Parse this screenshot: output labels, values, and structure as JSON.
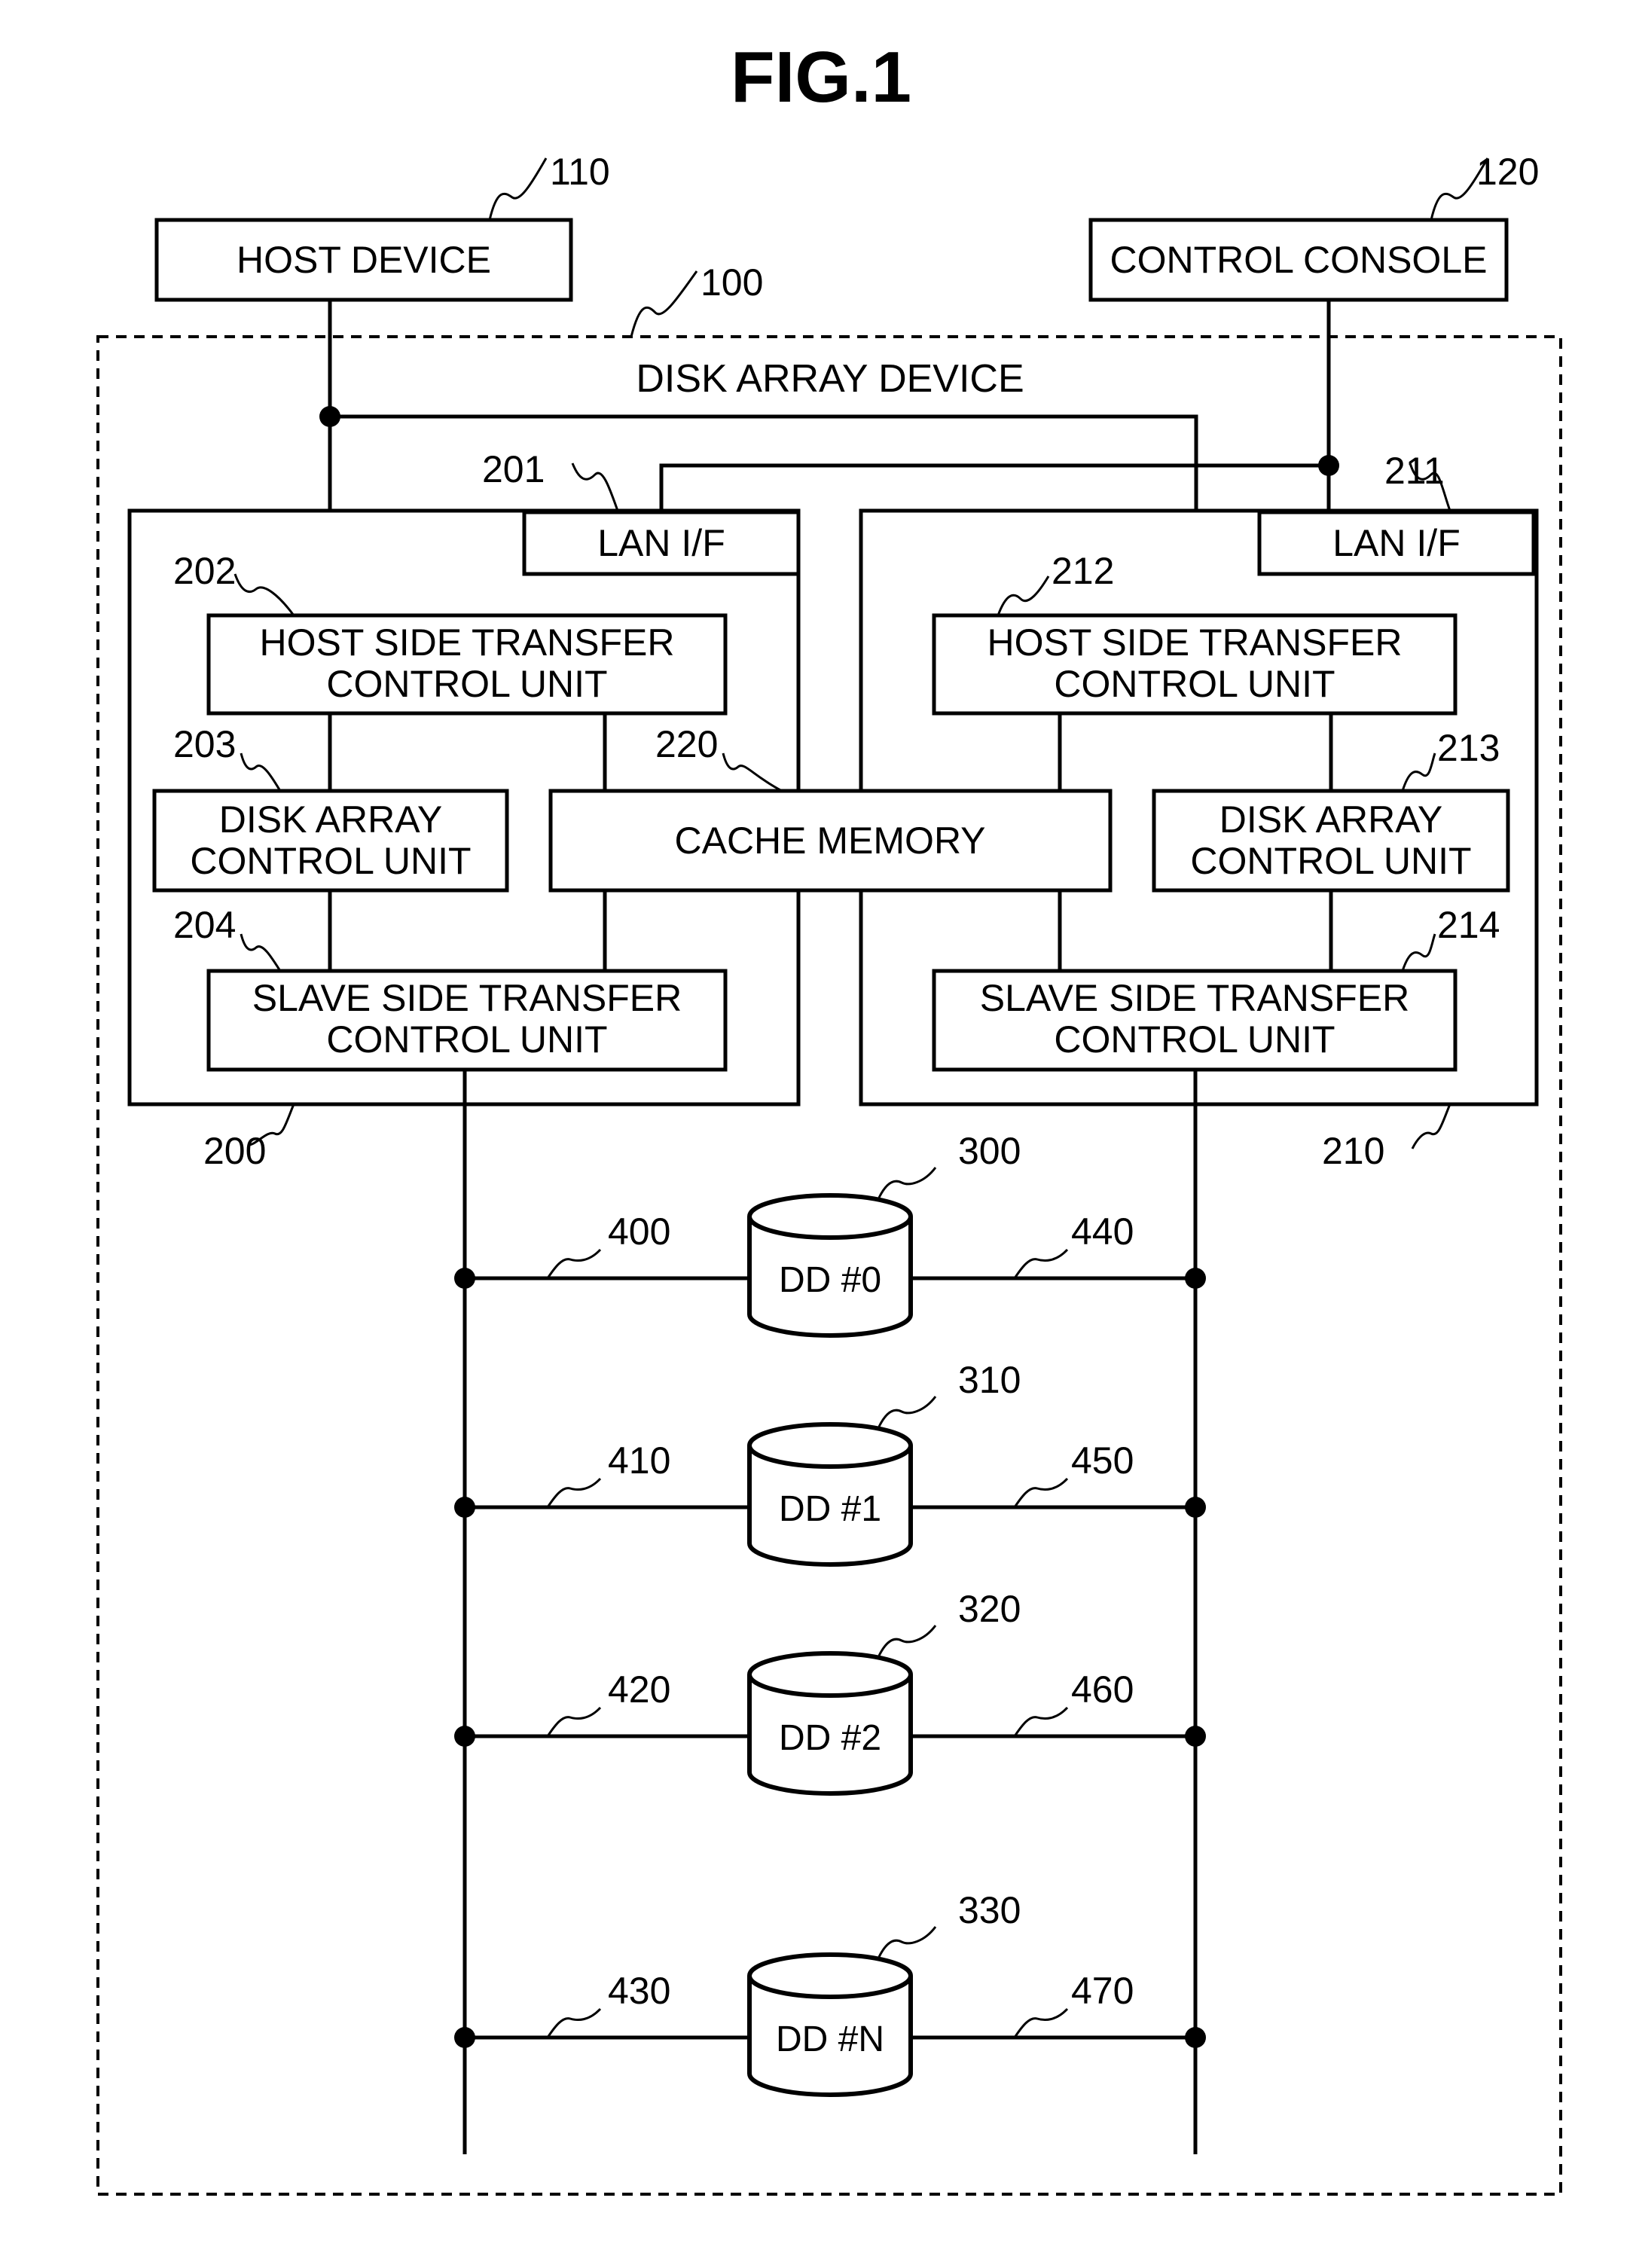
{
  "figure": {
    "title": "FIG.1"
  },
  "external": {
    "host_device": {
      "ref": "110",
      "label": "HOST DEVICE"
    },
    "control_console": {
      "ref": "120",
      "label": "CONTROL CONSOLE"
    }
  },
  "disk_array_device": {
    "ref": "100",
    "label": "DISK ARRAY DEVICE"
  },
  "controllers": [
    {
      "ref": "200",
      "lan_if": {
        "ref": "201",
        "label": "LAN I/F"
      },
      "host_side": {
        "ref": "202",
        "line1": "HOST SIDE TRANSFER",
        "line2": "CONTROL UNIT"
      },
      "disk_array_ctrl": {
        "ref": "203",
        "line1": "DISK ARRAY",
        "line2": "CONTROL UNIT"
      },
      "slave_side": {
        "ref": "204",
        "line1": "SLAVE SIDE TRANSFER",
        "line2": "CONTROL UNIT"
      }
    },
    {
      "ref": "210",
      "lan_if": {
        "ref": "211",
        "label": "LAN I/F"
      },
      "host_side": {
        "ref": "212",
        "line1": "HOST SIDE TRANSFER",
        "line2": "CONTROL UNIT"
      },
      "disk_array_ctrl": {
        "ref": "213",
        "line1": "DISK ARRAY",
        "line2": "CONTROL UNIT"
      },
      "slave_side": {
        "ref": "214",
        "line1": "SLAVE SIDE TRANSFER",
        "line2": "CONTROL UNIT"
      }
    }
  ],
  "cache_memory": {
    "ref": "220",
    "label": "CACHE MEMORY"
  },
  "disks": [
    {
      "ref": "300",
      "label": "DD #0",
      "left_path": "400",
      "right_path": "440"
    },
    {
      "ref": "310",
      "label": "DD #1",
      "left_path": "410",
      "right_path": "450"
    },
    {
      "ref": "320",
      "label": "DD #2",
      "left_path": "420",
      "right_path": "460"
    },
    {
      "ref": "330",
      "label": "DD #N",
      "left_path": "430",
      "right_path": "470"
    }
  ]
}
